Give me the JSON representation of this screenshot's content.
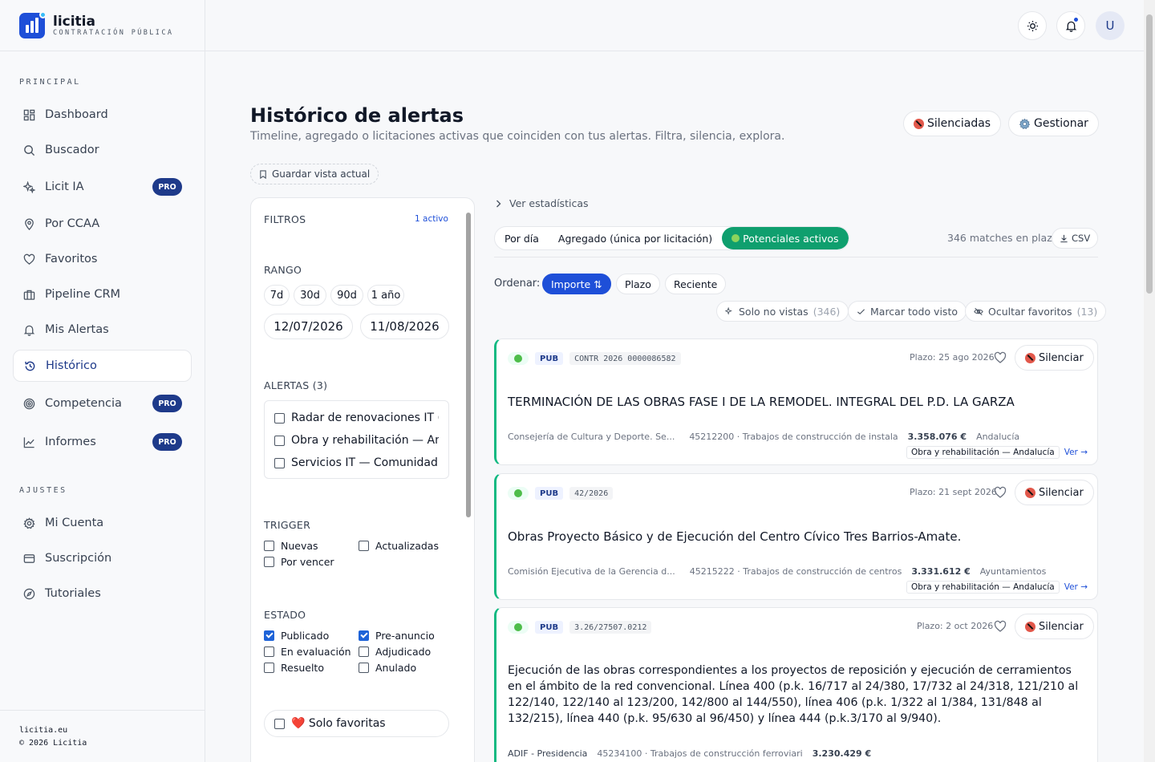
{
  "brand": {
    "name": "licitia",
    "subtitle": "CONTRATACIÓN PÚBLICA"
  },
  "sidebar": {
    "principal_label": "PRINCIPAL",
    "ajustes_label": "AJUSTES",
    "items": [
      {
        "label": "Dashboard",
        "icon": "dashboard-icon"
      },
      {
        "label": "Buscador",
        "icon": "search-icon"
      },
      {
        "label": "Licit IA",
        "icon": "sparkles-icon",
        "badge": "PRO"
      },
      {
        "label": "Por CCAA",
        "icon": "map-pin-icon"
      },
      {
        "label": "Favoritos",
        "icon": "heart-icon"
      },
      {
        "label": "Pipeline CRM",
        "icon": "briefcase-icon"
      },
      {
        "label": "Mis Alertas",
        "icon": "bell-icon"
      },
      {
        "label": "Histórico",
        "icon": "history-icon",
        "active": true
      },
      {
        "label": "Competencia",
        "icon": "target-icon",
        "badge": "PRO"
      },
      {
        "label": "Informes",
        "icon": "chart-line-icon",
        "badge": "PRO"
      }
    ],
    "settings": [
      {
        "label": "Mi Cuenta",
        "icon": "gear-icon"
      },
      {
        "label": "Suscripción",
        "icon": "credit-card-icon"
      },
      {
        "label": "Tutoriales",
        "icon": "compass-icon"
      }
    ],
    "footer_site": "licitia.eu",
    "footer_copy": "© 2026 Licitia"
  },
  "topbar": {
    "avatar": "U"
  },
  "header": {
    "title": "Histórico de alertas",
    "subtitle": "Timeline, agregado o licitaciones activas que coinciden con tus alertas. Filtra, silencia, explora.",
    "silenced_label": "Silenciadas",
    "manage_label": "Gestionar",
    "save_view": "Guardar vista actual"
  },
  "filters": {
    "title": "FILTROS",
    "active": "1 activo",
    "range_title": "RANGO",
    "ranges": [
      "7d",
      "30d",
      "90d",
      "1 año"
    ],
    "date_from": "12/07/2026",
    "date_to": "11/08/2026",
    "alerts_title": "ALERTAS (3)",
    "alerts": [
      "Radar de renovaciones IT (...",
      "Obra y rehabilitación — An...",
      "Servicios IT — Comunidad ..."
    ],
    "trigger_title": "TRIGGER",
    "triggers": [
      {
        "label": "Nuevas",
        "checked": false
      },
      {
        "label": "Actualizadas",
        "checked": false
      },
      {
        "label": "Por vencer",
        "checked": false
      }
    ],
    "estado_title": "ESTADO",
    "estados": [
      {
        "label": "Publicado",
        "checked": true
      },
      {
        "label": "Pre-anuncio",
        "checked": true
      },
      {
        "label": "En evaluación",
        "checked": false
      },
      {
        "label": "Adjudicado",
        "checked": false
      },
      {
        "label": "Resuelto",
        "checked": false
      },
      {
        "label": "Anulado",
        "checked": false
      }
    ],
    "fav_label": "❤️ Solo favoritas"
  },
  "content": {
    "stats_link": "Ver estadísticas",
    "tabs": [
      "Por día",
      "Agregado (única por licitación)",
      "Potenciales activos"
    ],
    "matches": "346 matches en plazo",
    "csv": "CSV",
    "sort_label": "Ordenar:",
    "sort": [
      "Importe ⇅",
      "Plazo",
      "Reciente"
    ],
    "tools": [
      {
        "label": "Solo no vistas",
        "count": "(346)"
      },
      {
        "label": "Marcar todo visto",
        "count": ""
      },
      {
        "label": "Ocultar favoritos",
        "count": "(13)"
      }
    ],
    "silence_label": "Silenciar",
    "cards": [
      {
        "pub": "PUB",
        "code": "CONTR 2026 0000086582",
        "plazo": "Plazo: 25 ago 2026",
        "title": "TERMINACIÓN DE LAS OBRAS FASE I DE LA REMODEL. INTEGRAL DEL P.D. LA GARZA",
        "organ": "Consejería de Cultura y Deporte. Se...",
        "cpv": "45212200 · Trabajos de construcción de instala",
        "amount": "3.358.076 €",
        "region": "Andalucía",
        "tag": "Obra y rehabilitación — Andalucía",
        "view": "Ver →"
      },
      {
        "pub": "PUB",
        "code": "42/2026",
        "plazo": "Plazo: 21 sept 2026",
        "title": "Obras Proyecto Básico y de Ejecución del Centro Cívico Tres Barrios-Amate.",
        "organ": "Comisión Ejecutiva de la Gerencia d...",
        "cpv": "45215222 · Trabajos de construcción de centros",
        "amount": "3.331.612 €",
        "region": "Ayuntamientos",
        "tag": "Obra y rehabilitación — Andalucía",
        "view": "Ver →"
      },
      {
        "pub": "PUB",
        "code": "3.26/27507.0212",
        "plazo": "Plazo: 2 oct 2026",
        "title": "Ejecución de las obras correspondientes a los proyectos de reposición y ejecución de cerramientos en el ámbito de la red convencional. Línea 400 (p.k. 16/717 al 24/380, 17/732 al 24/318, 121/210 al 122/140, 122/140 al 123/200, 142/800 al 144/550), línea 406 (p.k. 1/322 al 1/384, 131/848 al 132/215), línea 440 (p.k. 95/630 al 96/450) y línea 444 (p.k.3/170 al 9/940).",
        "organ": "ADIF - Presidencia",
        "cpv": "45234100 · Trabajos de construcción ferroviari",
        "amount": "3.230.429 €",
        "region": "",
        "tag": "",
        "view": ""
      }
    ]
  }
}
